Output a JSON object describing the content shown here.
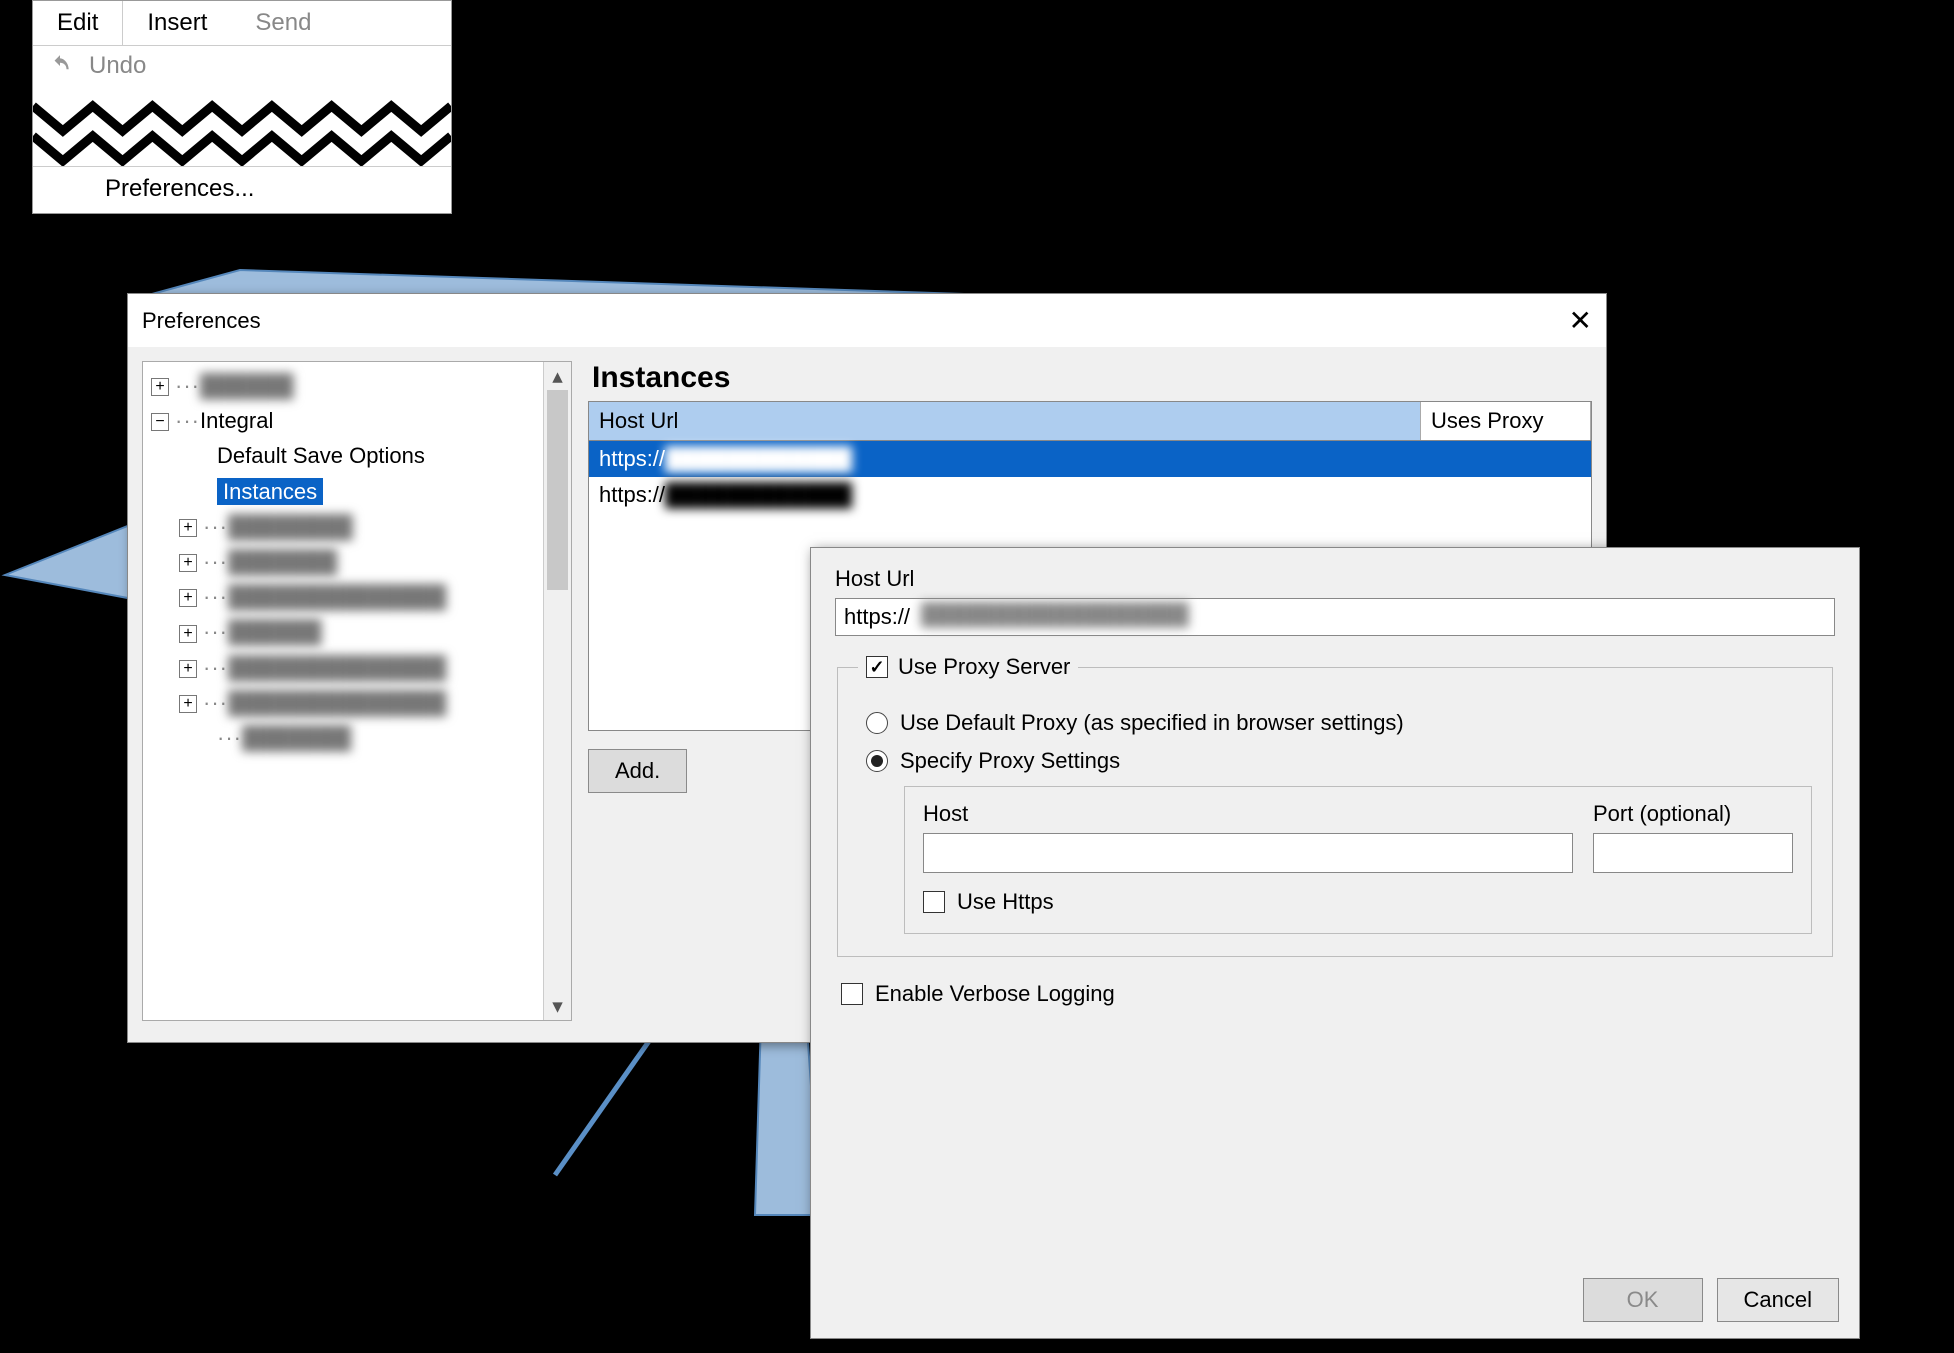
{
  "menu": {
    "tabs": [
      "Edit",
      "Insert",
      "Send"
    ],
    "undo_label": "Undo",
    "pref_label": "Preferences..."
  },
  "prefs": {
    "title": "Preferences",
    "tree": {
      "integral_label": "Integral",
      "default_save_label": "Default Save Options",
      "instances_label": "Instances"
    },
    "panel": {
      "heading": "Instances",
      "col_host": "Host Url",
      "col_proxy": "Uses Proxy",
      "rows": [
        {
          "url": "https://"
        },
        {
          "url": "https://"
        }
      ],
      "add_label": "Add."
    }
  },
  "host_dialog": {
    "hosturl_label": "Host Url",
    "hosturl_value": "https://",
    "use_proxy_label": "Use Proxy Server",
    "use_proxy_checked": true,
    "radio_default_label": "Use Default Proxy (as specified in browser settings)",
    "radio_specify_label": "Specify Proxy Settings",
    "radio_selected": "specify",
    "host_label": "Host",
    "port_label": "Port (optional)",
    "host_value": "",
    "port_value": "",
    "use_https_label": "Use Https",
    "use_https_checked": false,
    "verbose_label": "Enable Verbose Logging",
    "verbose_checked": false,
    "ok_label": "OK",
    "cancel_label": "Cancel"
  }
}
